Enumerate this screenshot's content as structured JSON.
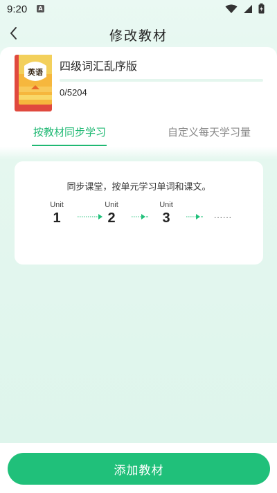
{
  "status_bar": {
    "time": "9:20",
    "notification_glyph": "A",
    "icons": [
      "wifi-icon",
      "signal-icon",
      "battery-icon"
    ]
  },
  "nav": {
    "title": "修改教材",
    "back_icon": "chevron-left-icon"
  },
  "book": {
    "title": "四级词汇乱序版",
    "cover_text": "英语",
    "progress_text": "0/5204",
    "progress_fraction": 0.0
  },
  "tabs": [
    {
      "label": "按教材同步学习",
      "active": true
    },
    {
      "label": "自定义每天学习量",
      "active": false
    }
  ],
  "intro": {
    "description": "同步课堂，按单元学习单词和课文。",
    "units": [
      {
        "label": "Unit",
        "number": "1"
      },
      {
        "label": "Unit",
        "number": "2"
      },
      {
        "label": "Unit",
        "number": "3"
      }
    ],
    "ellipsis": "......"
  },
  "actions": {
    "add_button_label": "添加教材"
  },
  "colors": {
    "accent": "#20c07a",
    "active_tab": "#1fb873",
    "inactive_tab": "#8a8a8a",
    "background_tint": "#e5f7ef"
  }
}
